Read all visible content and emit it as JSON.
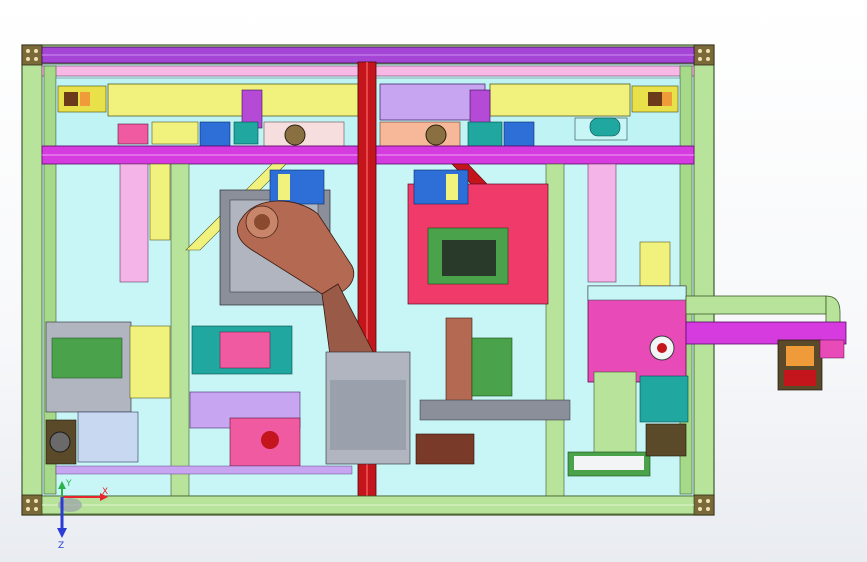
{
  "viewport": {
    "background_top": "#ffffff",
    "background_bottom": "#e9ecf1"
  },
  "model": {
    "colors": {
      "frame_green": "#b8e39a",
      "frame_edge": "#3f5a2c",
      "interior": "#c8f6f7",
      "purple_beam": "#a545d6",
      "magenta_beam": "#d63be0",
      "red_post": "#c4141c",
      "yellow_part": "#f1f27e",
      "pink_block": "#f05aa0",
      "robot_arm": "#b46a52",
      "blue_part": "#2d6fd6",
      "orange_part": "#f09b3a",
      "gray_part": "#8a8f9a",
      "lavender": "#c7a5f0",
      "dark_olive": "#5a4a2a",
      "green_base": "#4aa34a",
      "white_part": "#f2f4f6"
    }
  },
  "triad": {
    "x_label": "X",
    "y_label": "Y",
    "z_label": "Z",
    "x_color": "#e8252c",
    "y_color": "#2bb34a",
    "z_color": "#2b3bd6"
  }
}
